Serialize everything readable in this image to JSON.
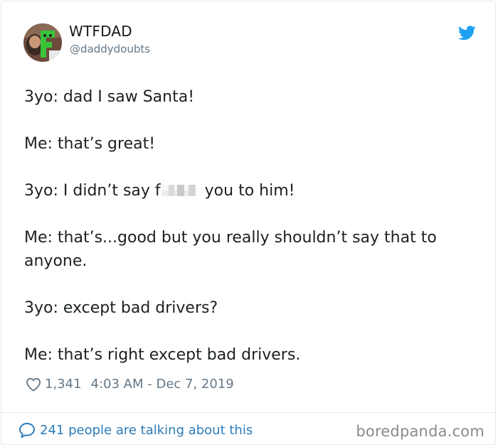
{
  "user": {
    "display_name": "WTFDAD",
    "handle": "@daddydoubts"
  },
  "tweet": {
    "line1": "3yo: dad I saw Santa!",
    "line2": "Me: that’s great!",
    "line3_before": "3yo: I didn’t say f",
    "line3_after": " you to him!",
    "line4": "Me: that’s...good but you really shouldn’t say that to anyone.",
    "line5": "3yo: except bad drivers?",
    "line6": "Me: that’s right except bad drivers."
  },
  "meta": {
    "likes": "1,341",
    "timestamp": "4:03 AM - Dec 7, 2019"
  },
  "footer": {
    "talking": "241 people are talking about this",
    "watermark": "boredpanda.com"
  },
  "icons": {
    "bird": "twitter-bird-icon",
    "heart": "heart-icon",
    "bubble": "speech-bubble-icon"
  },
  "colors": {
    "twitter_blue": "#1da1f2",
    "link_blue": "#2b7bb9",
    "meta_gray": "#657786",
    "text": "#1c2022"
  }
}
